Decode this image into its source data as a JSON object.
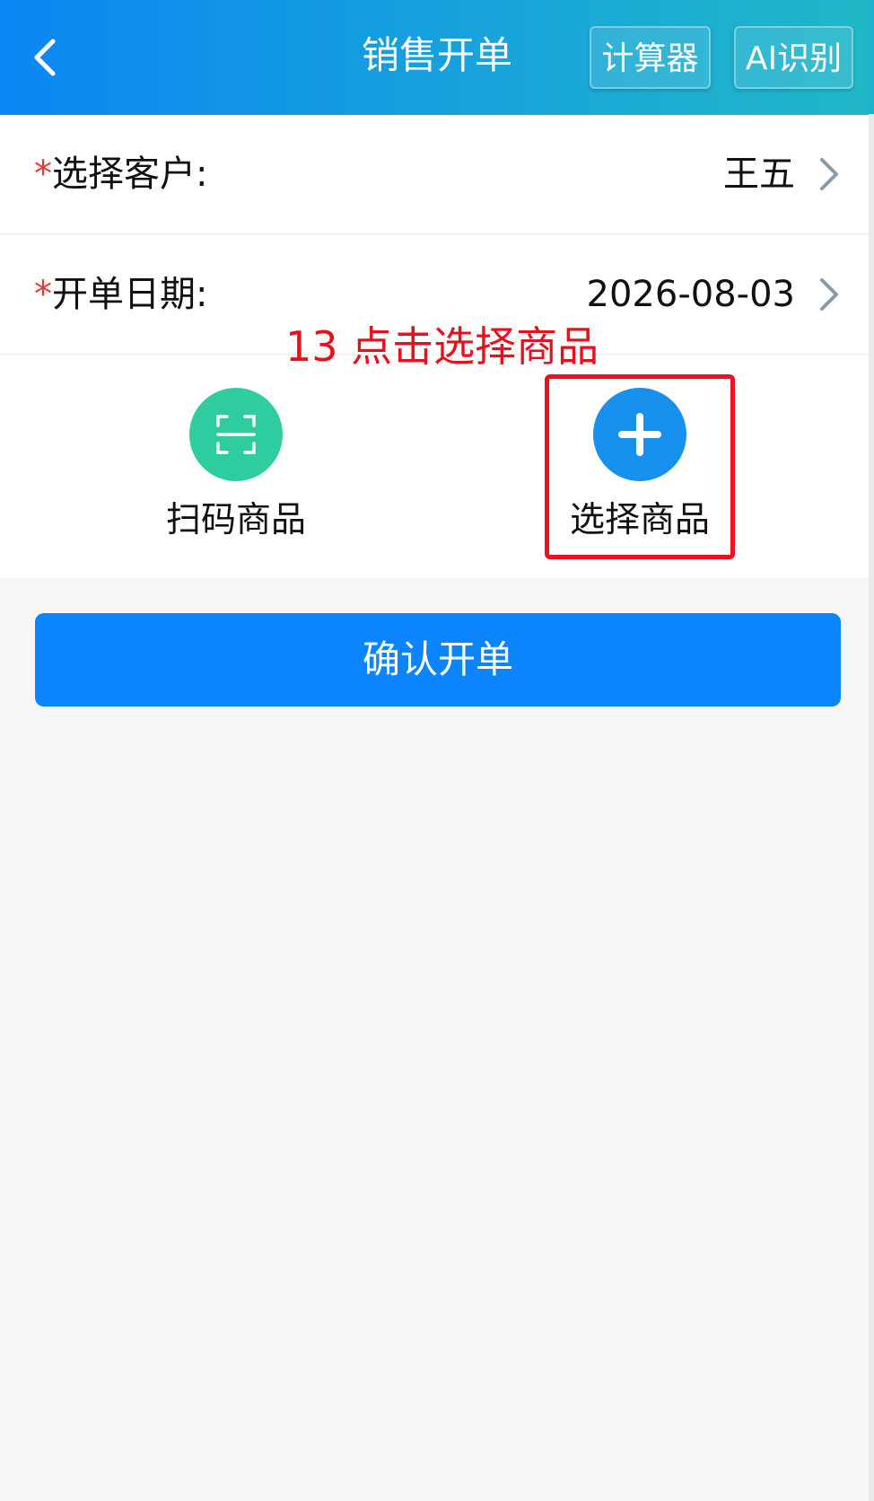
{
  "header": {
    "title": "销售开单",
    "back_icon": "back-arrow-icon",
    "calculator_label": "计算器",
    "ai_label": "AI识别"
  },
  "form": {
    "customer": {
      "required_mark": "*",
      "label": "选择客户:",
      "value": "王五"
    },
    "date": {
      "required_mark": "*",
      "label": "开单日期:",
      "value": "2026-08-03"
    }
  },
  "annotation": {
    "text": "13 点击选择商品",
    "color": "#e8101c"
  },
  "actions": {
    "scan": {
      "label": "扫码商品",
      "icon": "scan-icon",
      "color": "#2fcca0"
    },
    "select": {
      "label": "选择商品",
      "icon": "plus-icon",
      "color": "#1890ee"
    }
  },
  "confirm": {
    "label": "确认开单",
    "color": "#0b84fe"
  },
  "colors": {
    "header_start": "#0b86f3",
    "header_end": "#22b7c8",
    "required": "#e53935",
    "highlight": "#ee1020"
  }
}
